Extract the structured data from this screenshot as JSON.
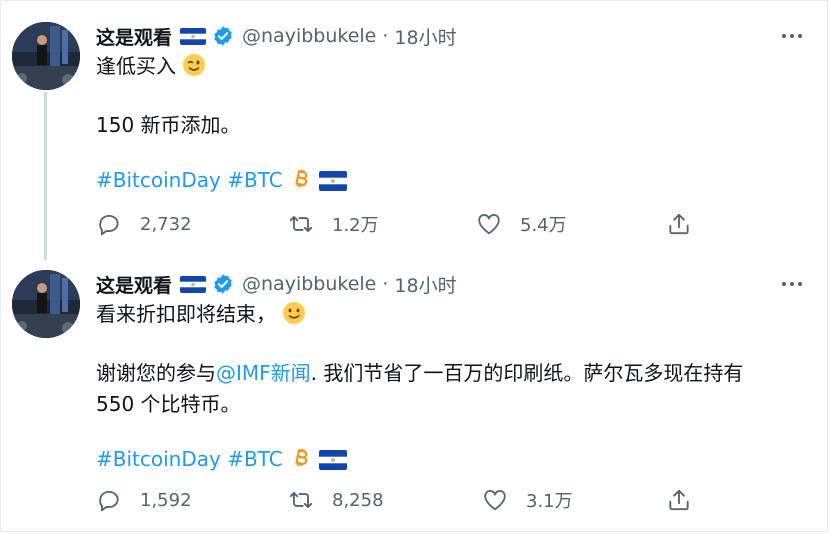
{
  "tweets": [
    {
      "name": "这是观看",
      "handle": "@nayibbukele",
      "separator": "·",
      "time": "18小时",
      "line1": "逢低买入",
      "line2": "150 新币添加。",
      "hashtags": [
        "#BitcoinDay",
        "#BTC"
      ],
      "reply_count": "2,732",
      "retweet_count": "1.2万",
      "like_count": "5.4万"
    },
    {
      "name": "这是观看",
      "handle": "@nayibbukele",
      "separator": "·",
      "time": "18小时",
      "line1": "看来折扣即将结束，",
      "line2_pre": "谢谢您的参与",
      "mention": "@IMF新闻",
      "line2_post": ". 我们节省了一百万的印刷纸。萨尔瓦多现在持有",
      "line3": "550 个比特币。",
      "hashtags": [
        "#BitcoinDay",
        "#BTC"
      ],
      "reply_count": "1,592",
      "retweet_count": "8,258",
      "like_count": "3.1万"
    }
  ],
  "icons": {
    "flag": "el-salvador-flag-icon",
    "verified": "verified-badge-icon",
    "bitcoin": "bitcoin-icon",
    "reply": "reply-icon",
    "retweet": "retweet-icon",
    "like": "heart-icon",
    "share": "share-icon",
    "more": "more-icon"
  },
  "colors": {
    "link": "#1d9bf0",
    "secondary": "#536471",
    "verified": "#1d9bf0",
    "bitcoin": "#f7931a",
    "flag_blue": "#0f47af"
  }
}
